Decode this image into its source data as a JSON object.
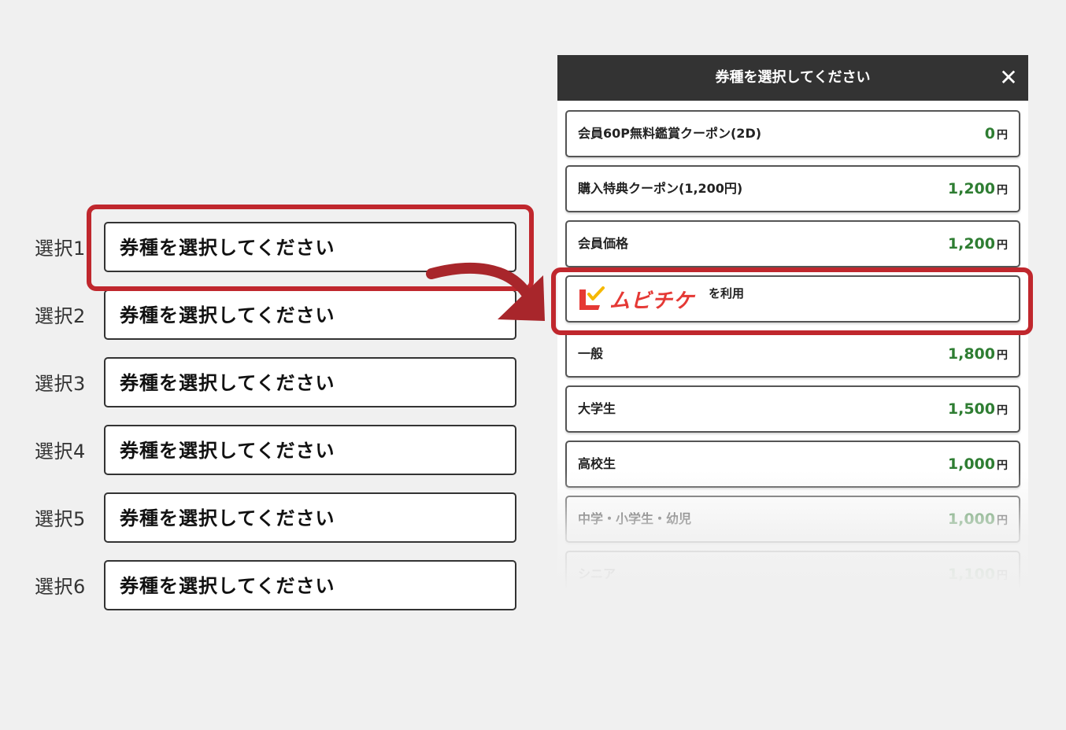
{
  "selects": [
    {
      "label": "選択1",
      "value": "券種を選択してください"
    },
    {
      "label": "選択2",
      "value": "券種を選択してください"
    },
    {
      "label": "選択3",
      "value": "券種を選択してください"
    },
    {
      "label": "選択4",
      "value": "券種を選択してください"
    },
    {
      "label": "選択5",
      "value": "券種を選択してください"
    },
    {
      "label": "選択6",
      "value": "券種を選択してください"
    }
  ],
  "modal": {
    "title": "券種を選択してください",
    "close_glyph": "✕",
    "options": [
      {
        "name": "会員60P無料鑑賞クーポン(2D)",
        "price": "0",
        "yen": "円"
      },
      {
        "name": "購入特典クーポン(1,200円)",
        "price": "1,200",
        "yen": "円"
      },
      {
        "name": "会員価格",
        "price": "1,200",
        "yen": "円"
      },
      {
        "name": "一般",
        "price": "1,800",
        "yen": "円"
      },
      {
        "name": "大学生",
        "price": "1,500",
        "yen": "円"
      },
      {
        "name": "高校生",
        "price": "1,000",
        "yen": "円"
      },
      {
        "name": "中学・小学生・幼児",
        "price": "1,000",
        "yen": "円"
      },
      {
        "name": "シニア",
        "price": "1,100",
        "yen": "円"
      }
    ],
    "mubichike": {
      "logo_text": "ムビチケ",
      "suffix": "を利用"
    }
  },
  "colors": {
    "highlight": "#c0272d",
    "price": "#2e7d32",
    "header": "#333333"
  }
}
